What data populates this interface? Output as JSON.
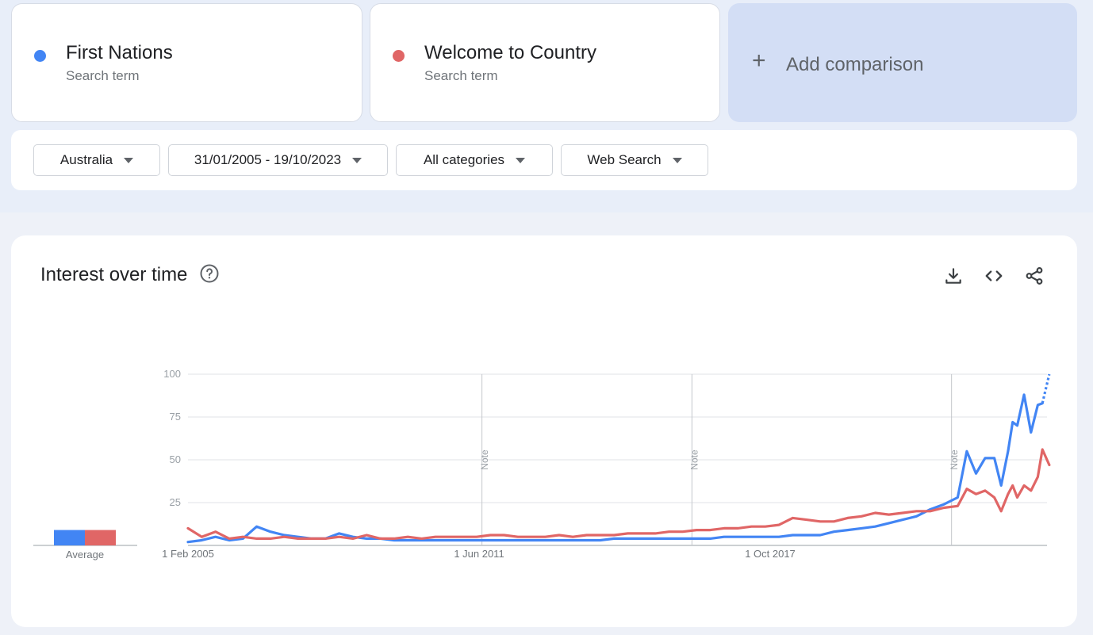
{
  "terms": [
    {
      "name": "First Nations",
      "sub": "Search term",
      "color": "#4285f4"
    },
    {
      "name": "Welcome to Country",
      "sub": "Search term",
      "color": "#e06666"
    }
  ],
  "add_comparison": {
    "icon": "plus-icon",
    "label": "Add comparison"
  },
  "filters": {
    "region": "Australia",
    "date_range": "31/01/2005 - 19/10/2023",
    "category": "All categories",
    "search_type": "Web Search"
  },
  "panel": {
    "title": "Interest over time",
    "help_icon": "help-circle-icon",
    "actions": [
      "download-icon",
      "embed-code-icon",
      "share-icon"
    ]
  },
  "chart_data": {
    "type": "line",
    "y_ticks": [
      100,
      75,
      50,
      25
    ],
    "ylim": [
      0,
      100
    ],
    "x_labels": [
      "1 Feb 2005",
      "1 Jun 2011",
      "1 Oct 2017"
    ],
    "x_range": [
      "2005-01",
      "2023-10"
    ],
    "notes": [
      {
        "label": "Note",
        "date": "2011-06"
      },
      {
        "label": "Note",
        "date": "2016-01"
      },
      {
        "label": "Note",
        "date": "2021-09"
      }
    ],
    "average": {
      "label": "Average",
      "values": [
        9,
        9
      ]
    },
    "grid": true,
    "partial_last_point": true,
    "series": [
      {
        "color": "#4285f4",
        "points": [
          [
            2005.0,
            2
          ],
          [
            2005.3,
            3
          ],
          [
            2005.6,
            5
          ],
          [
            2005.9,
            3
          ],
          [
            2006.2,
            4
          ],
          [
            2006.5,
            11
          ],
          [
            2006.8,
            8
          ],
          [
            2007.1,
            6
          ],
          [
            2007.4,
            5
          ],
          [
            2007.7,
            4
          ],
          [
            2008.0,
            4
          ],
          [
            2008.3,
            7
          ],
          [
            2008.6,
            5
          ],
          [
            2008.9,
            4
          ],
          [
            2009.2,
            4
          ],
          [
            2009.5,
            3
          ],
          [
            2009.8,
            3
          ],
          [
            2010.1,
            3
          ],
          [
            2010.4,
            3
          ],
          [
            2010.7,
            3
          ],
          [
            2011.0,
            3
          ],
          [
            2011.3,
            3
          ],
          [
            2011.6,
            3
          ],
          [
            2011.9,
            3
          ],
          [
            2012.2,
            3
          ],
          [
            2012.5,
            3
          ],
          [
            2012.8,
            3
          ],
          [
            2013.1,
            3
          ],
          [
            2013.4,
            3
          ],
          [
            2013.7,
            3
          ],
          [
            2014.0,
            3
          ],
          [
            2014.3,
            4
          ],
          [
            2014.6,
            4
          ],
          [
            2014.9,
            4
          ],
          [
            2015.2,
            4
          ],
          [
            2015.5,
            4
          ],
          [
            2015.8,
            4
          ],
          [
            2016.1,
            4
          ],
          [
            2016.4,
            4
          ],
          [
            2016.7,
            5
          ],
          [
            2017.0,
            5
          ],
          [
            2017.3,
            5
          ],
          [
            2017.6,
            5
          ],
          [
            2017.9,
            5
          ],
          [
            2018.2,
            6
          ],
          [
            2018.5,
            6
          ],
          [
            2018.8,
            6
          ],
          [
            2019.1,
            8
          ],
          [
            2019.4,
            9
          ],
          [
            2019.7,
            10
          ],
          [
            2020.0,
            11
          ],
          [
            2020.3,
            13
          ],
          [
            2020.6,
            15
          ],
          [
            2020.9,
            17
          ],
          [
            2021.2,
            21
          ],
          [
            2021.5,
            24
          ],
          [
            2021.8,
            28
          ],
          [
            2022.0,
            55
          ],
          [
            2022.2,
            42
          ],
          [
            2022.4,
            51
          ],
          [
            2022.6,
            51
          ],
          [
            2022.75,
            35
          ],
          [
            2022.9,
            55
          ],
          [
            2023.0,
            72
          ],
          [
            2023.1,
            70
          ],
          [
            2023.25,
            88
          ],
          [
            2023.4,
            66
          ],
          [
            2023.55,
            82
          ],
          [
            2023.65,
            83
          ]
        ],
        "projected": [
          [
            2023.65,
            83
          ],
          [
            2023.8,
            100
          ]
        ]
      },
      {
        "color": "#e06666",
        "points": [
          [
            2005.0,
            10
          ],
          [
            2005.3,
            5
          ],
          [
            2005.6,
            8
          ],
          [
            2005.9,
            4
          ],
          [
            2006.2,
            5
          ],
          [
            2006.5,
            4
          ],
          [
            2006.8,
            4
          ],
          [
            2007.1,
            5
          ],
          [
            2007.4,
            4
          ],
          [
            2007.7,
            4
          ],
          [
            2008.0,
            4
          ],
          [
            2008.3,
            5
          ],
          [
            2008.6,
            4
          ],
          [
            2008.9,
            6
          ],
          [
            2009.2,
            4
          ],
          [
            2009.5,
            4
          ],
          [
            2009.8,
            5
          ],
          [
            2010.1,
            4
          ],
          [
            2010.4,
            5
          ],
          [
            2010.7,
            5
          ],
          [
            2011.0,
            5
          ],
          [
            2011.3,
            5
          ],
          [
            2011.6,
            6
          ],
          [
            2011.9,
            6
          ],
          [
            2012.2,
            5
          ],
          [
            2012.5,
            5
          ],
          [
            2012.8,
            5
          ],
          [
            2013.1,
            6
          ],
          [
            2013.4,
            5
          ],
          [
            2013.7,
            6
          ],
          [
            2014.0,
            6
          ],
          [
            2014.3,
            6
          ],
          [
            2014.6,
            7
          ],
          [
            2014.9,
            7
          ],
          [
            2015.2,
            7
          ],
          [
            2015.5,
            8
          ],
          [
            2015.8,
            8
          ],
          [
            2016.1,
            9
          ],
          [
            2016.4,
            9
          ],
          [
            2016.7,
            10
          ],
          [
            2017.0,
            10
          ],
          [
            2017.3,
            11
          ],
          [
            2017.6,
            11
          ],
          [
            2017.9,
            12
          ],
          [
            2018.2,
            16
          ],
          [
            2018.5,
            15
          ],
          [
            2018.8,
            14
          ],
          [
            2019.1,
            14
          ],
          [
            2019.4,
            16
          ],
          [
            2019.7,
            17
          ],
          [
            2020.0,
            19
          ],
          [
            2020.3,
            18
          ],
          [
            2020.6,
            19
          ],
          [
            2020.9,
            20
          ],
          [
            2021.2,
            20
          ],
          [
            2021.5,
            22
          ],
          [
            2021.8,
            23
          ],
          [
            2022.0,
            33
          ],
          [
            2022.2,
            30
          ],
          [
            2022.4,
            32
          ],
          [
            2022.6,
            28
          ],
          [
            2022.75,
            20
          ],
          [
            2022.9,
            30
          ],
          [
            2023.0,
            35
          ],
          [
            2023.1,
            28
          ],
          [
            2023.25,
            35
          ],
          [
            2023.4,
            32
          ],
          [
            2023.55,
            40
          ],
          [
            2023.65,
            56
          ],
          [
            2023.8,
            47
          ]
        ]
      }
    ]
  }
}
